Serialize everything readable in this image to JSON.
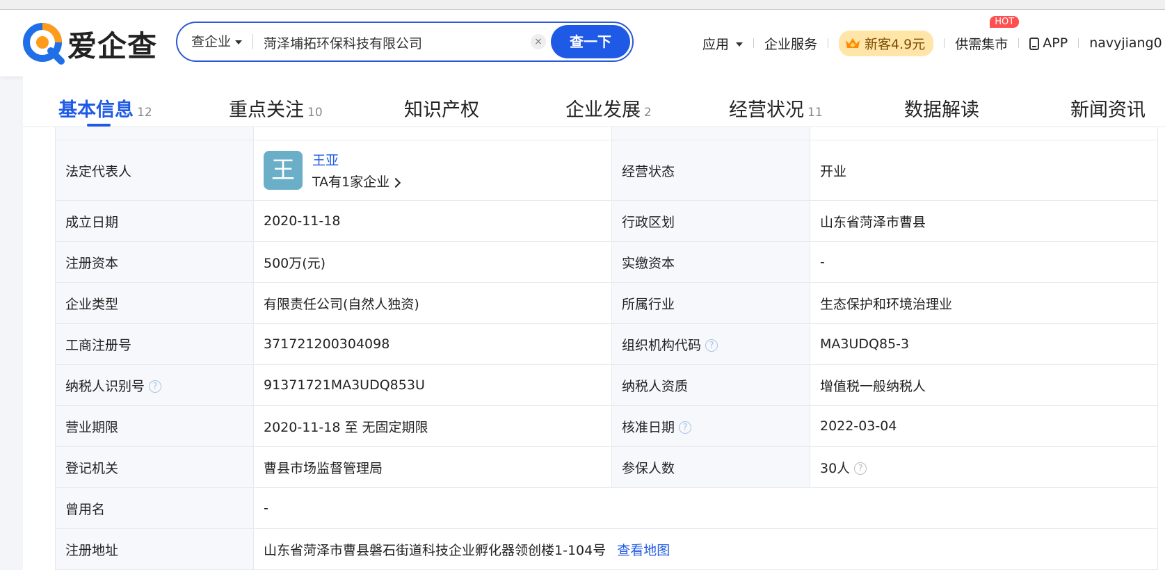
{
  "header": {
    "logo_text": "爱企查",
    "search_type": "查企业",
    "search_value": "菏泽埔拓环保科技有限公司",
    "clear_glyph": "×",
    "search_button": "查一下",
    "nav": {
      "apps": "应用",
      "enterprise_service": "企业服务",
      "vip_offer": "新客4.9元",
      "supply_demand": "供需集市",
      "hot_badge": "HOT",
      "app": "APP",
      "username": "navyjiang0"
    }
  },
  "tabs": [
    {
      "label": "基本信息",
      "count": "12"
    },
    {
      "label": "重点关注",
      "count": "10"
    },
    {
      "label": "知识产权",
      "count": ""
    },
    {
      "label": "企业发展",
      "count": "2"
    },
    {
      "label": "经营状况",
      "count": "11"
    },
    {
      "label": "数据解读",
      "count": ""
    },
    {
      "label": "新闻资讯",
      "count": ""
    }
  ],
  "info": {
    "legal_rep_label": "法定代表人",
    "legal_rep_avatar": "王",
    "legal_rep_name": "王亚",
    "legal_rep_sub": "TA有1家企业",
    "status_label": "经营状态",
    "status_value": "开业",
    "founded_label": "成立日期",
    "founded_value": "2020-11-18",
    "region_label": "行政区划",
    "region_value": "山东省菏泽市曹县",
    "reg_capital_label": "注册资本",
    "reg_capital_value": "500万(元)",
    "paid_capital_label": "实缴资本",
    "paid_capital_value": "-",
    "type_label": "企业类型",
    "type_value": "有限责任公司(自然人独资)",
    "industry_label": "所属行业",
    "industry_value": "生态保护和环境治理业",
    "reg_no_label": "工商注册号",
    "reg_no_value": "371721200304098",
    "org_code_label": "组织机构代码",
    "org_code_value": "MA3UDQ85-3",
    "tax_id_label": "纳税人识别号",
    "tax_id_value": "91371721MA3UDQ853U",
    "tax_qual_label": "纳税人资质",
    "tax_qual_value": "增值税一般纳税人",
    "term_label": "营业期限",
    "term_value": "2020-11-18 至 无固定期限",
    "approve_label": "核准日期",
    "approve_value": "2022-03-04",
    "authority_label": "登记机关",
    "authority_value": "曹县市场监督管理局",
    "insured_label": "参保人数",
    "insured_value": "30人",
    "former_name_label": "曾用名",
    "former_name_value": "-",
    "address_label": "注册地址",
    "address_value": "山东省菏泽市曹县磐石街道科技企业孵化器领创楼1-104号",
    "map_link": "查看地图",
    "help_glyph": "?"
  }
}
